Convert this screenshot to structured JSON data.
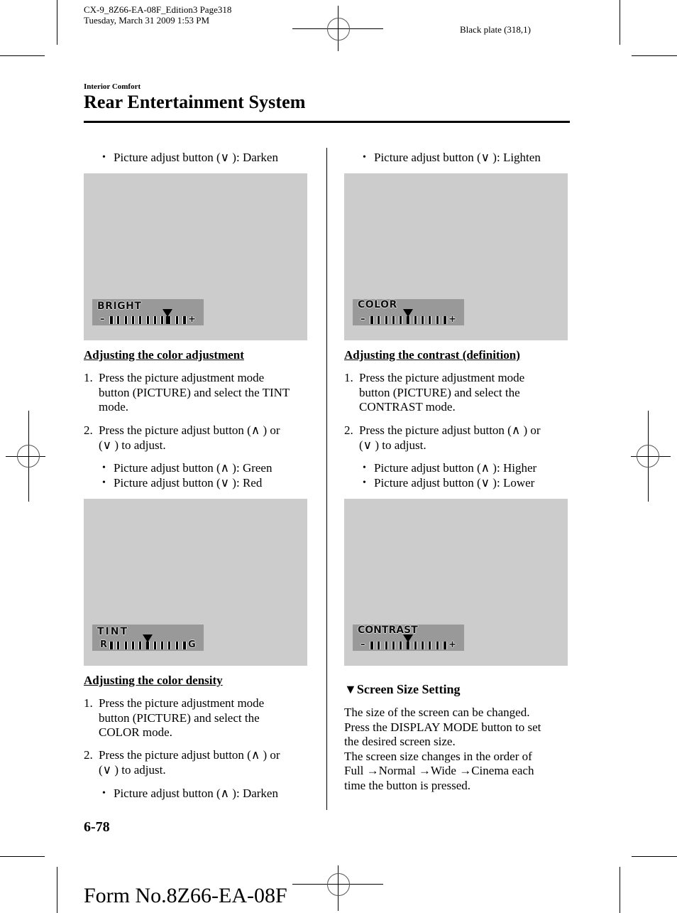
{
  "print_header": {
    "job_line": "CX-9_8Z66-EA-08F_Edition3 Page318",
    "date_line": "Tuesday, March 31 2009 1:53 PM",
    "plate": "Black plate (318,1)"
  },
  "section": "Interior Comfort",
  "title": "Rear Entertainment System",
  "left_column": {
    "top_bullet": "Picture adjust button (∨ ): Darken",
    "osd_bright": {
      "label": "BRIGHT",
      "min_symbol": "–",
      "max_symbol": "+",
      "level_fraction": 0.78
    },
    "color_adjustment": {
      "heading": "Adjusting the color adjustment",
      "steps": [
        {
          "num": "1.",
          "lines": [
            "Press the picture adjustment mode",
            "button (PICTURE) and select the TINT",
            "mode."
          ]
        },
        {
          "num": "2.",
          "lines": [
            "Press the picture adjust button (∧ ) or",
            "(∨ ) to adjust."
          ]
        }
      ],
      "bullets": [
        "Picture adjust button (∧ ): Green",
        "Picture adjust button (∨ ): Red"
      ]
    },
    "osd_tint": {
      "label": "TINT",
      "min_symbol": "R",
      "max_symbol": "G",
      "level_fraction": 0.5
    },
    "color_density": {
      "heading": "Adjusting the color density",
      "steps": [
        {
          "num": "1.",
          "lines": [
            "Press the picture adjustment mode",
            "button (PICTURE) and select the",
            "COLOR mode."
          ]
        },
        {
          "num": "2.",
          "lines": [
            "Press the picture adjust button (∧ ) or",
            "(∨ ) to adjust."
          ]
        }
      ],
      "bullets": [
        "Picture adjust button (∧ ): Darken"
      ]
    }
  },
  "right_column": {
    "top_bullet": "Picture adjust button (∨ ): Lighten",
    "osd_color": {
      "label": "COLOR",
      "min_symbol": "–",
      "max_symbol": "+",
      "level_fraction": 0.5
    },
    "contrast": {
      "heading": "Adjusting the contrast (definition)",
      "steps": [
        {
          "num": "1.",
          "lines": [
            "Press the picture adjustment mode",
            "button (PICTURE) and select the",
            "CONTRAST mode."
          ]
        },
        {
          "num": "2.",
          "lines": [
            "Press the picture adjust button (∧ ) or",
            "(∨ ) to adjust."
          ]
        }
      ],
      "bullets": [
        "Picture adjust button (∧ ): Higher",
        "Picture adjust button (∨ ): Lower"
      ]
    },
    "osd_contrast": {
      "label": "CONTRAST",
      "min_symbol": "–",
      "max_symbol": "+",
      "level_fraction": 0.5
    },
    "screen_size": {
      "heading_icon": "▼",
      "heading": "Screen Size Setting",
      "lines": [
        "The size of the screen can be changed.",
        "Press the DISPLAY MODE button to set",
        "the desired screen size.",
        "The screen size changes in the order of",
        "Full →Normal →Wide →Cinema each",
        "time the button is pressed."
      ]
    }
  },
  "page_number": "6-78",
  "form_number": "Form No.8Z66-EA-08F",
  "colors": {
    "screen_bg": "#cccccc",
    "osd_bg": "#999999",
    "text": "#000000"
  }
}
